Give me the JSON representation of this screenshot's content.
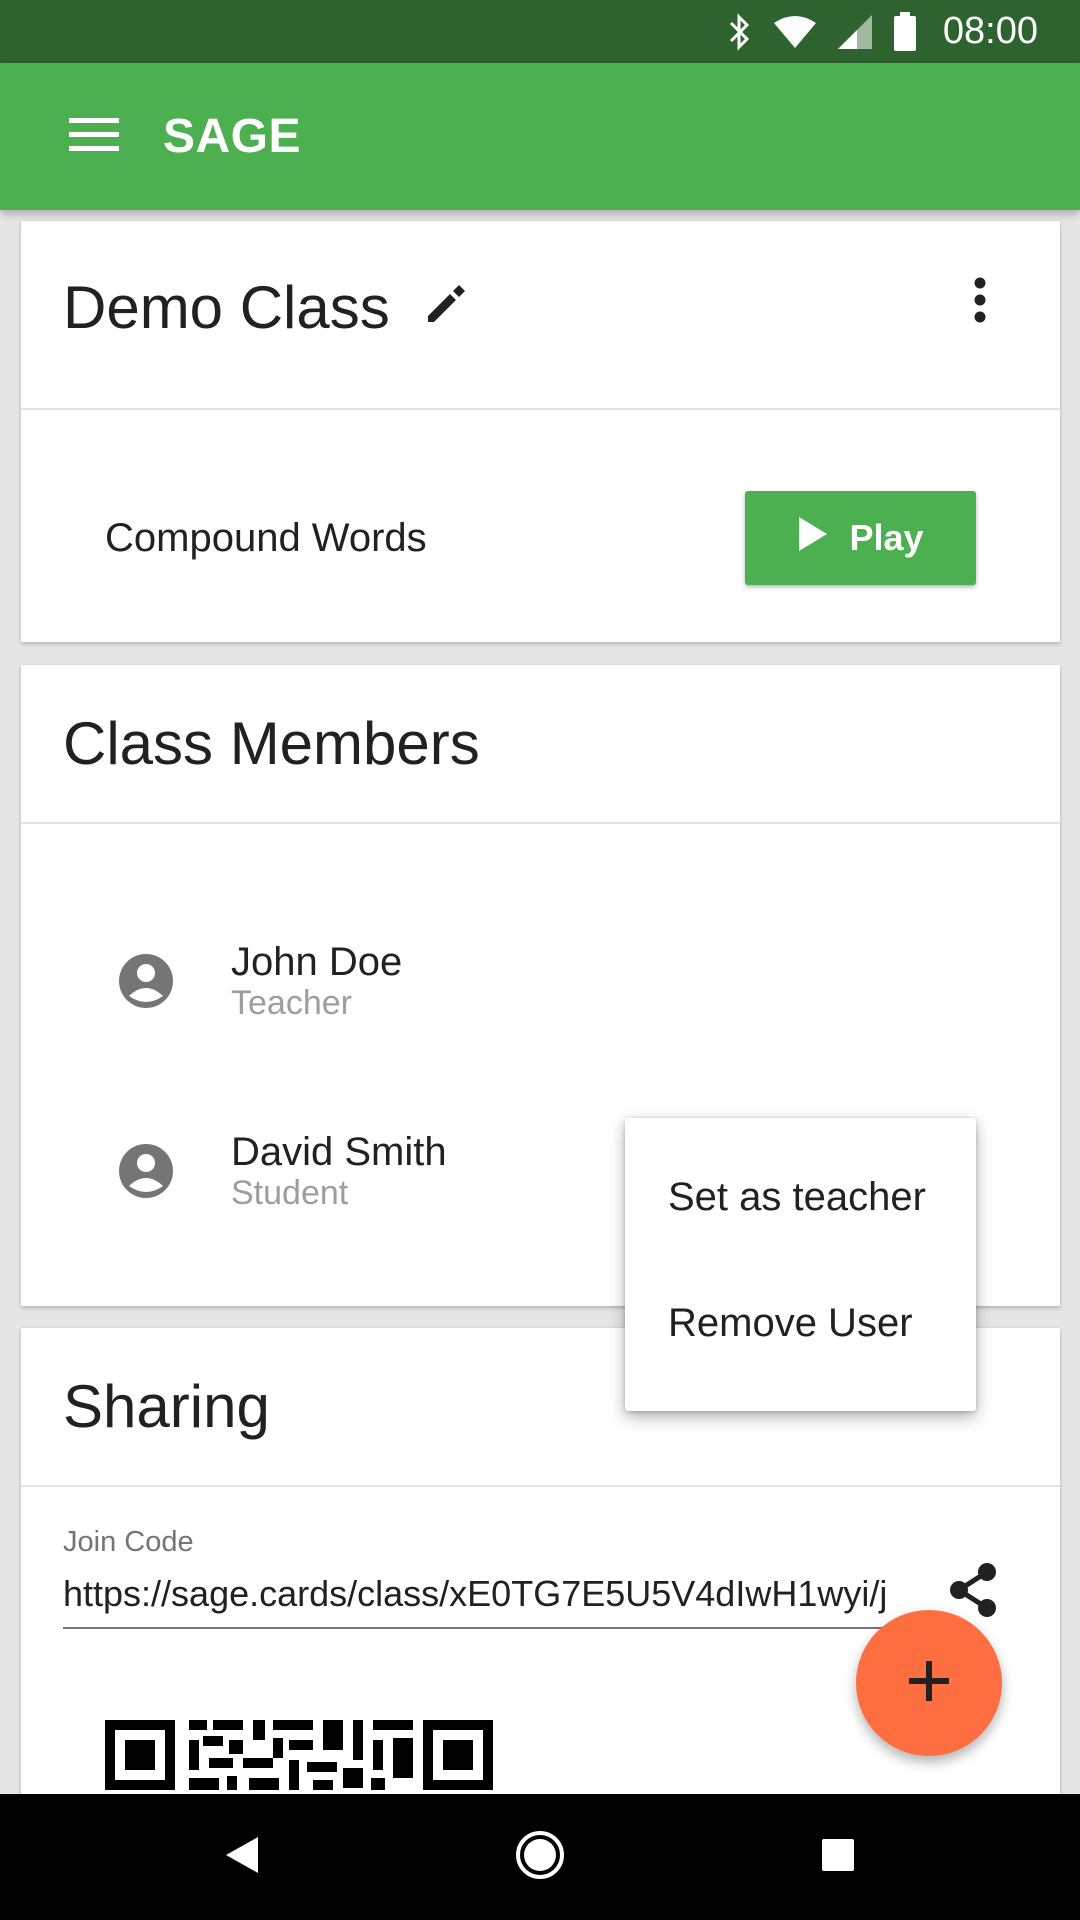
{
  "status_bar": {
    "time": "08:00",
    "icons": [
      "bluetooth-icon",
      "wifi-icon",
      "signal-icon",
      "battery-icon"
    ]
  },
  "app_bar": {
    "title": "SAGE",
    "menu_icon": "hamburger-menu-icon"
  },
  "class_card": {
    "title": "Demo Class",
    "lesson": "Compound Words",
    "play_label": "Play"
  },
  "members_card": {
    "title": "Class Members",
    "members": [
      {
        "name": "John Doe",
        "role": "Teacher"
      },
      {
        "name": "David Smith",
        "role": "Student"
      }
    ]
  },
  "sharing_card": {
    "title": "Sharing",
    "join_label": "Join Code",
    "join_value": "https://sage.cards/class/xE0TG7E5U5V4dIwH1wyi/j"
  },
  "popup_menu": {
    "items": [
      "Set as teacher",
      "Remove User"
    ]
  },
  "colors": {
    "status_bar": "#2e632f",
    "primary": "#4caf50",
    "accent": "#ff6e40"
  }
}
